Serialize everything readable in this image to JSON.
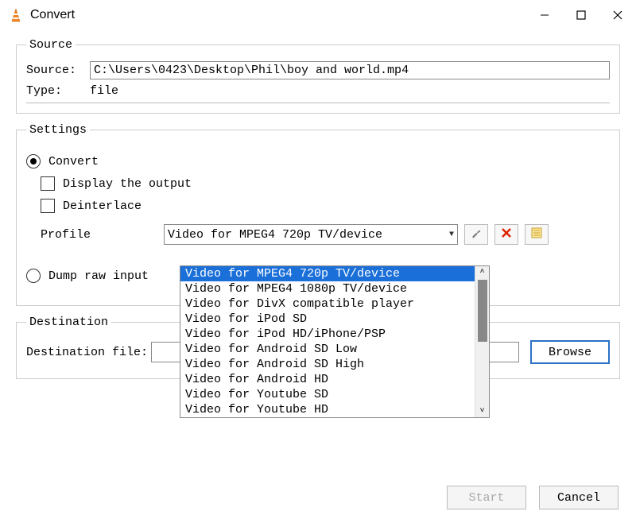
{
  "window": {
    "title": "Convert"
  },
  "source": {
    "legend": "Source",
    "source_label": "Source:",
    "source_value": "C:\\Users\\0423\\Desktop\\Phil\\boy and world.mp4",
    "type_label": "Type:",
    "type_value": "file"
  },
  "settings": {
    "legend": "Settings",
    "convert_label": "Convert",
    "display_output_label": "Display the output",
    "deinterlace_label": "Deinterlace",
    "profile_label": "Profile",
    "profile_selected": "Video for MPEG4 720p TV/device",
    "profile_options": [
      "Video for MPEG4 720p TV/device",
      "Video for MPEG4 1080p TV/device",
      "Video for DivX compatible player",
      "Video for iPod SD",
      "Video for iPod HD/iPhone/PSP",
      "Video for Android SD Low",
      "Video for Android SD High",
      "Video for Android HD",
      "Video for Youtube SD",
      "Video for Youtube HD"
    ],
    "dump_raw_label": "Dump raw input"
  },
  "destination": {
    "legend": "Destination",
    "file_label": "Destination file:",
    "browse_label": "Browse"
  },
  "buttons": {
    "start": "Start",
    "cancel": "Cancel"
  },
  "icons": {
    "wrench": "wrench-icon",
    "delete": "delete-icon",
    "new_profile": "new-profile-icon"
  }
}
